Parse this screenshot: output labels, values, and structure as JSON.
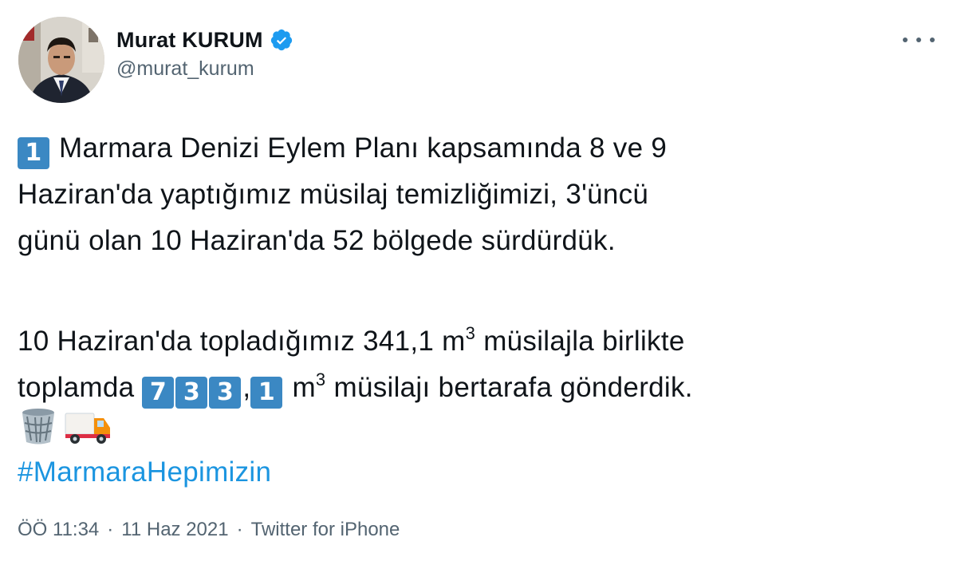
{
  "author": {
    "display_name": "Murat KURUM",
    "handle": "@murat_kurum",
    "verified_icon": "verified-badge-icon",
    "avatar_icon": "profile-photo"
  },
  "menu_icon": "more-options-icon",
  "tweet": {
    "line1_keycap": "1",
    "line1_text": "Marmara Denizi Eylem Planı kapsamında 8 ve 9",
    "line2_text": "Haziran'da yaptığımız müsilaj temizliğimizi, 3'üncü",
    "line3_text": "günü olan 10 Haziran'da 52 bölgede sürdürdük.",
    "line4_before_sup": "10 Haziran'da topladığımız 341,1 m",
    "line4_sup": "3",
    "line4_after_sup": " müsilajla birlikte",
    "line5_prefix": "toplamda ",
    "line5_keycaps": [
      "7",
      "3",
      "3",
      "1"
    ],
    "line5_comma": ",",
    "line5_unit": " m",
    "line5_sup": "3",
    "line5_suffix": " müsilajı bertarafa gönderdik.",
    "emojis": [
      "wastebasket-icon",
      "delivery-truck-icon"
    ],
    "hashtag": "#MarmaraHepimizin"
  },
  "meta": {
    "time": "ÖÖ 11:34",
    "separator": "·",
    "date": "11 Haz 2021",
    "source": "Twitter for iPhone"
  },
  "colors": {
    "keycap": "#3b88c3",
    "hashtag": "#1b95e0",
    "verified": "#1d9bf0",
    "secondary_text": "#536471"
  }
}
